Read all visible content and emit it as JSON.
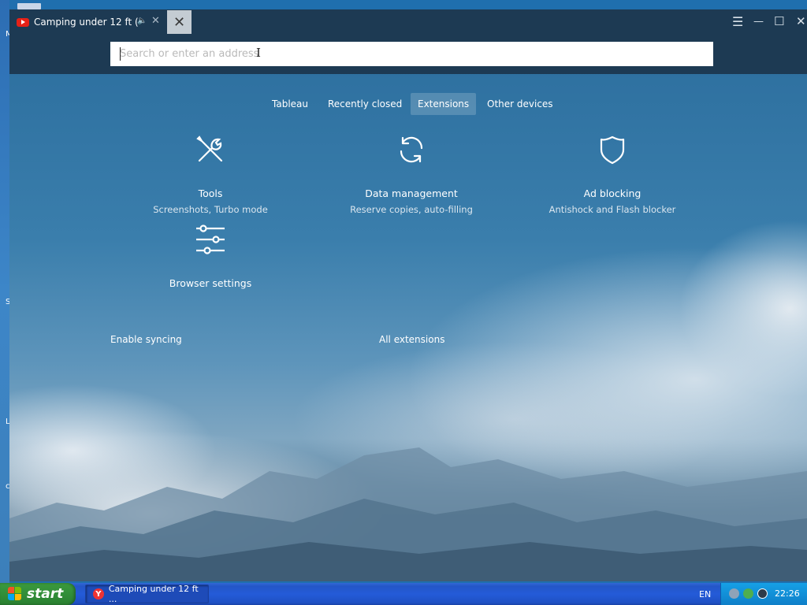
{
  "browser": {
    "tab_title": "Camping under 12 ft (",
    "tab_audio_icon": "speaker-icon",
    "address_placeholder": "Search or enter an address"
  },
  "nav_tabs": [
    {
      "label": "Tableau",
      "active": false
    },
    {
      "label": "Recently closed",
      "active": false
    },
    {
      "label": "Extensions",
      "active": true
    },
    {
      "label": "Other devices",
      "active": false
    }
  ],
  "features": {
    "tools": {
      "title": "Tools",
      "subtitle": "Screenshots, Turbo mode",
      "icon": "wrench-screwdriver-icon"
    },
    "data": {
      "title": "Data management",
      "subtitle": "Reserve copies, auto-filling",
      "icon": "sync-icon"
    },
    "adblock": {
      "title": "Ad blocking",
      "subtitle": "Antishock and Flash blocker",
      "icon": "shield-icon"
    },
    "settings": {
      "title": "Browser settings",
      "icon": "sliders-icon"
    }
  },
  "links": {
    "enable_syncing": "Enable syncing",
    "all_extensions": "All extensions"
  },
  "taskbar": {
    "start_label": "start",
    "task_label": "Camping under 12 ft ...",
    "language": "EN",
    "clock": "22:26"
  },
  "colors": {
    "browser_chrome": "#1d3a53",
    "active_tab_highlight": "#c4ccd3",
    "taskbar_blue": "#245bd8",
    "start_green": "#33913a",
    "youtube_red": "#e62117"
  }
}
